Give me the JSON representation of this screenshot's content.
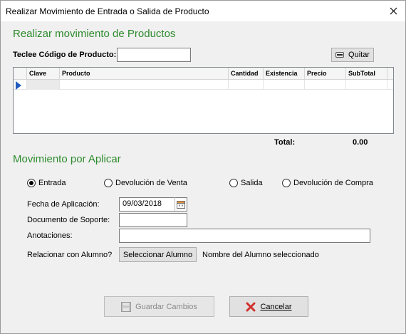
{
  "window": {
    "title": "Realizar Movimiento de Entrada o Salida de Producto"
  },
  "productos": {
    "section_title": "Realizar movimiento de Productos",
    "codigo_label": "Teclee Código de Producto:",
    "codigo_value": "",
    "quitar_label": "Quitar",
    "columns": [
      "Clave",
      "Producto",
      "Cantidad",
      "Existencia",
      "Precio",
      "SubTotal"
    ],
    "total_label": "Total:",
    "total_value": "0.00"
  },
  "movimiento": {
    "section_title": "Movimiento por Aplicar",
    "options": [
      "Entrada",
      "Devolución de Venta",
      "Salida",
      "Devolución de Compra"
    ],
    "selected": "Entrada",
    "fecha_label": "Fecha de Aplicación:",
    "fecha_value": "09/03/2018",
    "documento_label": "Documento de Soporte:",
    "documento_value": "",
    "anotaciones_label": "Anotaciones:",
    "anotaciones_value": "",
    "alumno_label": "Relacionar con Alumno?",
    "seleccionar_label": "Seleccionar Alumno",
    "alumno_nombre": "Nombre del Alumno seleccionado"
  },
  "actions": {
    "guardar_label": "Guardar Cambios",
    "cancelar_label": "Cancelar"
  },
  "colors": {
    "section_title": "#2e8b2e",
    "row_indicator": "#1e5bbd",
    "cancel_icon": "#d0312d"
  },
  "icons": {
    "close": "close-icon",
    "quitar": "minus-icon",
    "calendar": "calendar-icon",
    "save": "save-icon",
    "cancel": "x-icon"
  }
}
